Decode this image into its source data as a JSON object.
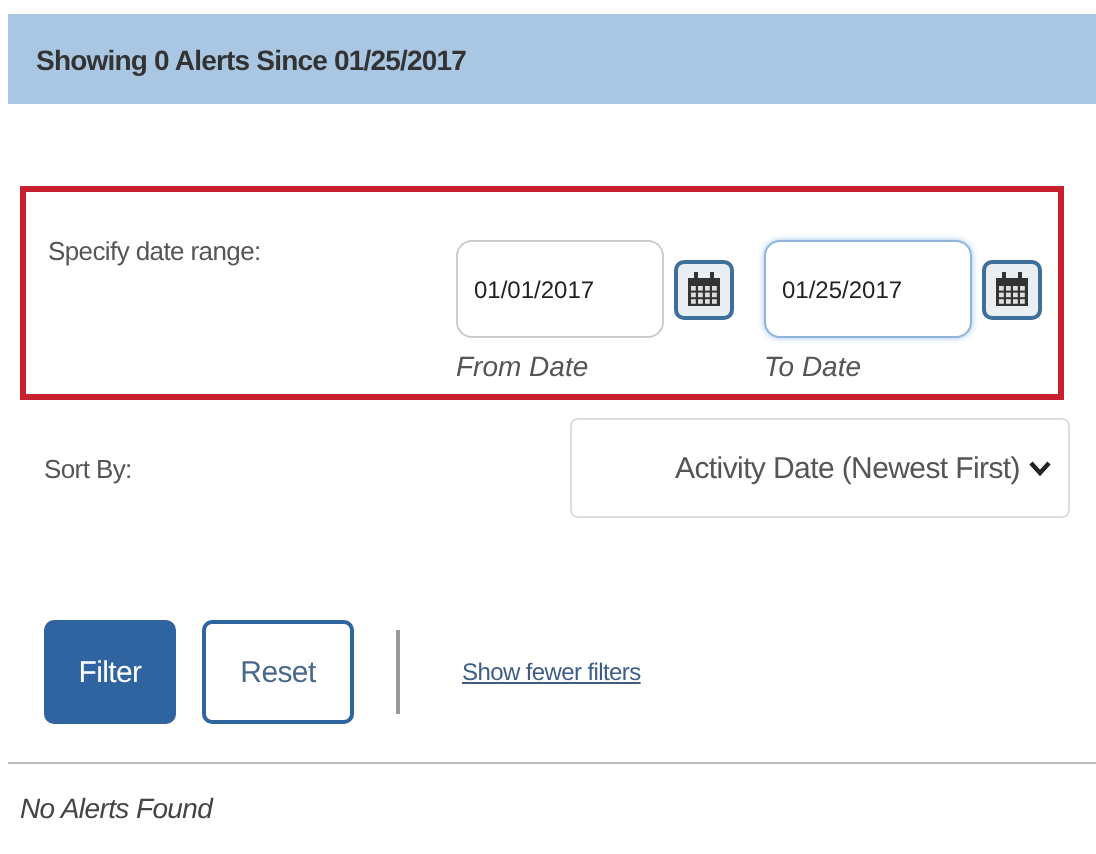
{
  "header": {
    "title": "Showing 0 Alerts Since 01/25/2017"
  },
  "date_range": {
    "label": "Specify date range:",
    "highlighted": true,
    "fields": [
      {
        "value": "01/01/2017",
        "caption": "From Date",
        "focused": false
      },
      {
        "value": "01/25/2017",
        "caption": "To Date",
        "focused": true
      }
    ]
  },
  "sort": {
    "label": "Sort By:",
    "value": "Activity Date (Newest First)"
  },
  "actions": {
    "buttons": [
      {
        "label": "Filter",
        "kind": "primary"
      },
      {
        "label": "Reset",
        "kind": "secondary"
      }
    ],
    "link": "Show fewer filters"
  },
  "results": {
    "message": "No Alerts Found"
  }
}
